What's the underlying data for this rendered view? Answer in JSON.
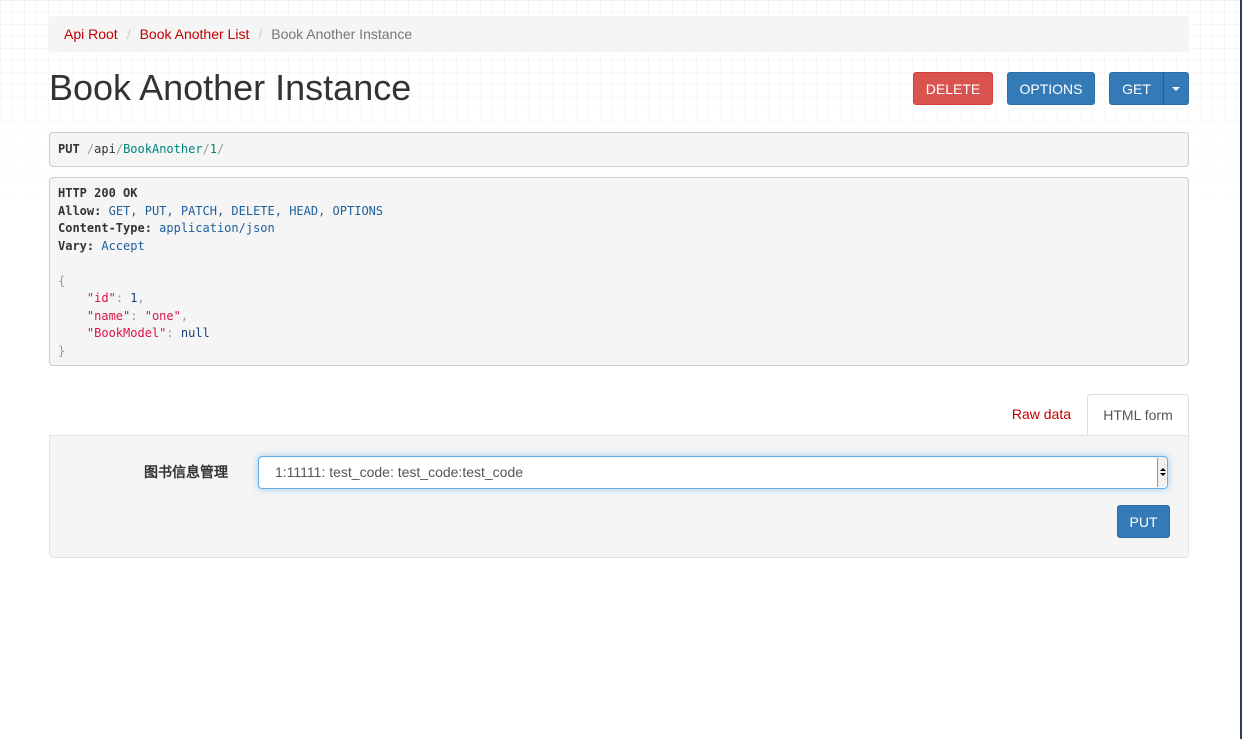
{
  "breadcrumb": {
    "items": [
      "Api Root",
      "Book Another List",
      "Book Another Instance"
    ]
  },
  "page": {
    "title": "Book Another Instance"
  },
  "actions": {
    "delete_label": "DELETE",
    "options_label": "OPTIONS",
    "get_label": "GET"
  },
  "request": {
    "method": "PUT",
    "path_parts": [
      "/",
      "api",
      "/",
      "BookAnother",
      "/",
      "1",
      "/"
    ]
  },
  "response": {
    "status_line": "HTTP 200 OK",
    "headers": [
      {
        "key": "Allow:",
        "value": "GET, PUT, PATCH, DELETE, HEAD, OPTIONS"
      },
      {
        "key": "Content-Type:",
        "value": "application/json"
      },
      {
        "key": "Vary:",
        "value": "Accept"
      }
    ],
    "body": {
      "open_brace": "{",
      "close_brace": "}",
      "fields": [
        {
          "key": "\"id\"",
          "value": "1",
          "trail": ","
        },
        {
          "key": "\"name\"",
          "value": "\"one\"",
          "trail": ","
        },
        {
          "key": "\"BookModel\"",
          "value": "null",
          "trail": ""
        }
      ]
    }
  },
  "tabs": {
    "raw": "Raw data",
    "html": "HTML form"
  },
  "form": {
    "label": "图书信息管理",
    "selected_value": "1:11111: test_code: test_code:test_code",
    "submit_label": "PUT"
  },
  "colors": {
    "link": "#c20000",
    "primary": "#337ab7",
    "danger": "#d9534f"
  }
}
